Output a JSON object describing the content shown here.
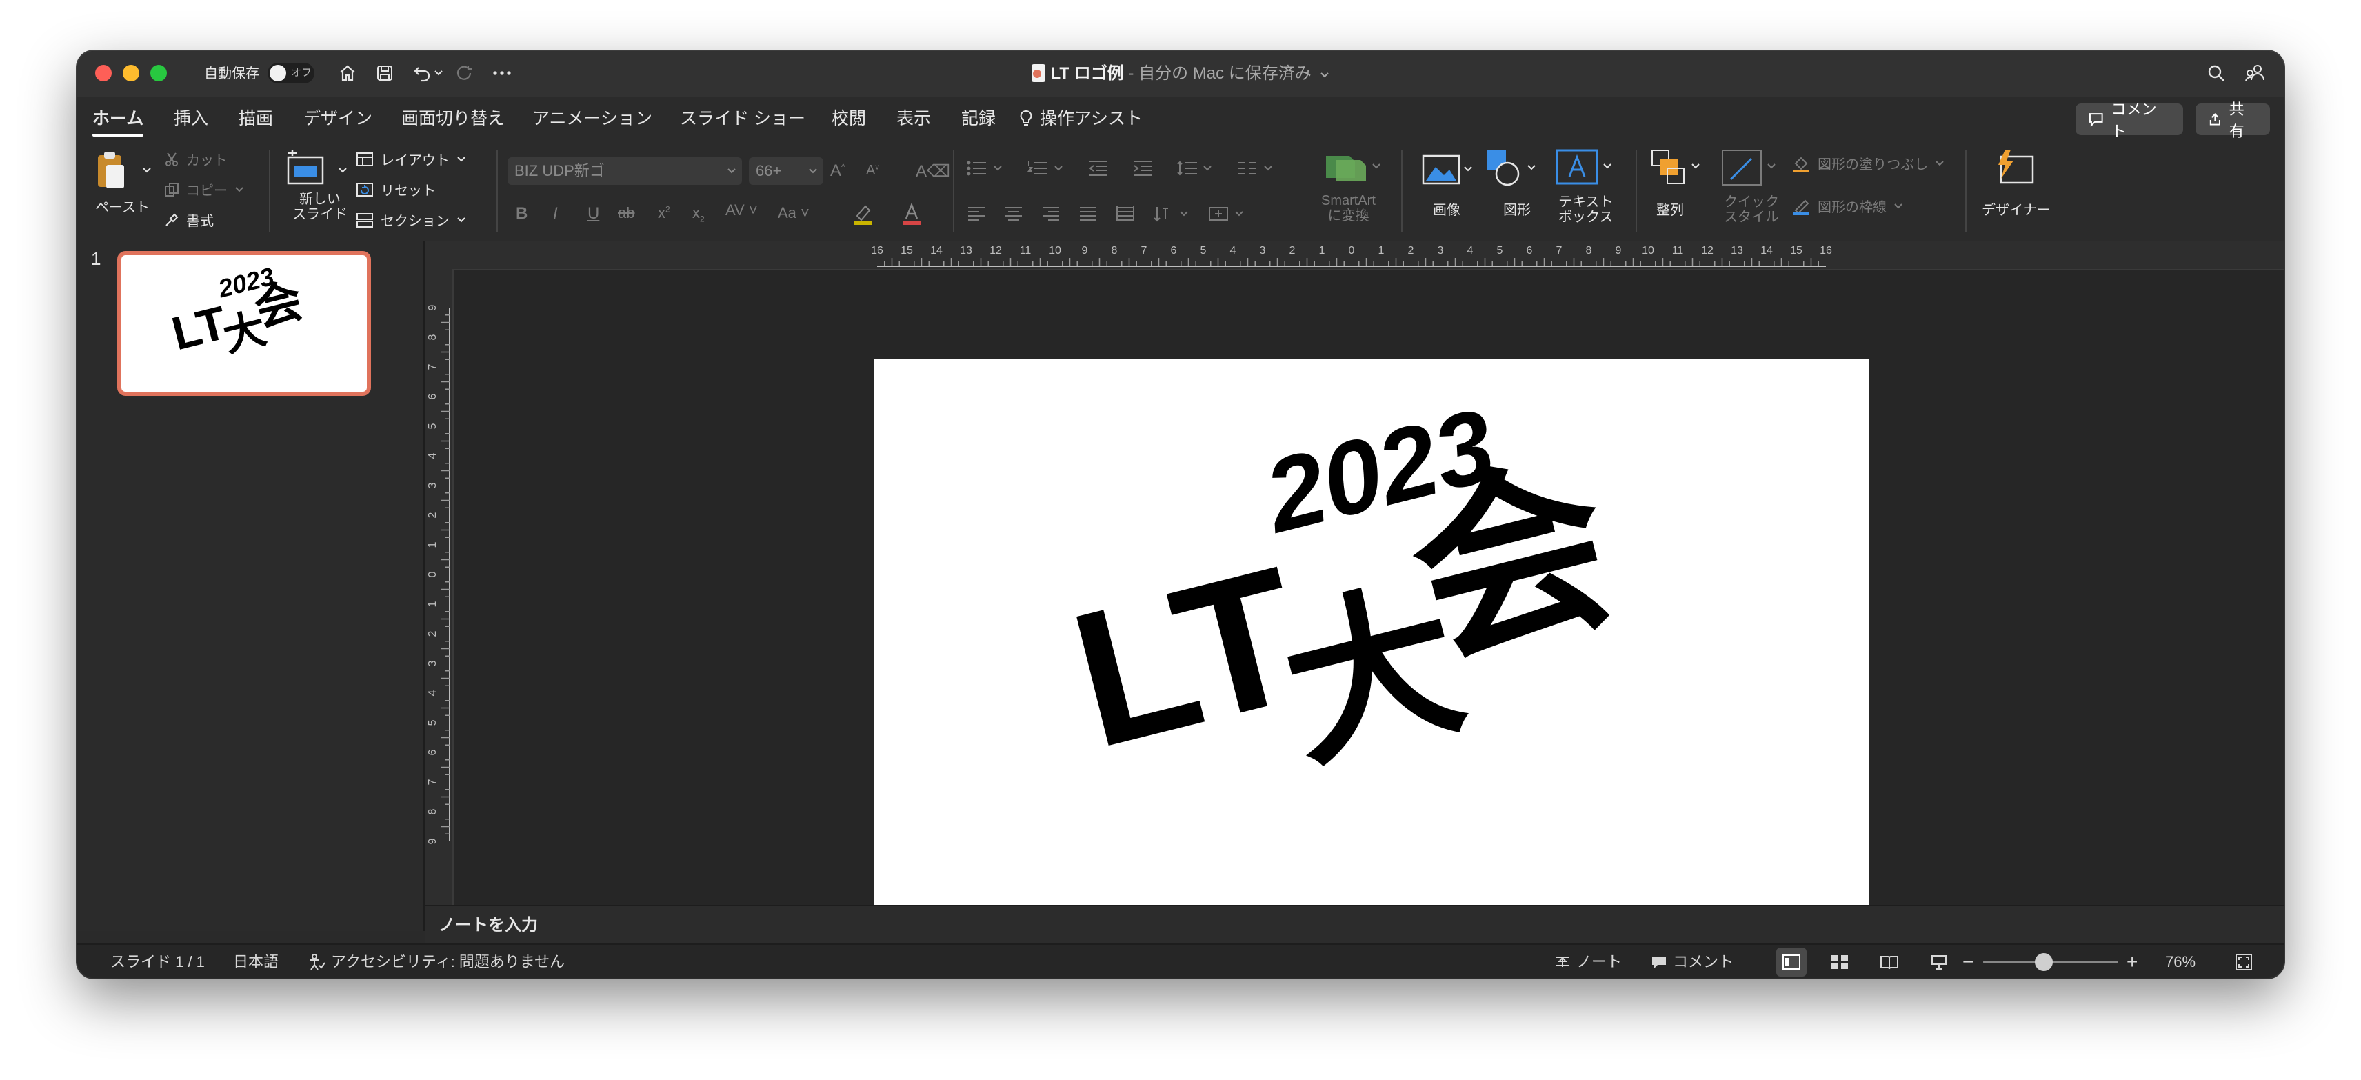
{
  "titlebar": {
    "autosave_label": "自動保存",
    "autosave_state": "オフ",
    "doc_name": "LT ロゴ例",
    "doc_location": " - 自分の Mac に保存済み",
    "icons": [
      "home-icon",
      "save-icon",
      "undo-icon",
      "redo-icon",
      "more-icon",
      "search-icon",
      "share-people-icon"
    ]
  },
  "tabs": [
    {
      "label": "ホーム",
      "active": true
    },
    {
      "label": "挿入"
    },
    {
      "label": "描画"
    },
    {
      "label": "デザイン"
    },
    {
      "label": "画面切り替え"
    },
    {
      "label": "アニメーション"
    },
    {
      "label": "スライド ショー"
    },
    {
      "label": "校閲"
    },
    {
      "label": "表示"
    },
    {
      "label": "記録"
    },
    {
      "label": "操作アシスト"
    }
  ],
  "actions": {
    "comment": "コメント",
    "share": "共有"
  },
  "ribbon": {
    "paste": "ペースト",
    "cut": "カット",
    "copy": "コピー",
    "format": "書式",
    "new_slide_1": "新しい",
    "new_slide_2": "スライド",
    "layout": "レイアウト",
    "reset": "リセット",
    "section": "セクション",
    "font_name": "BIZ UDP新ゴ",
    "font_size": "66+",
    "smartart_1": "SmartArt",
    "smartart_2": "に変換",
    "image": "画像",
    "shape": "図形",
    "textbox_1": "テキスト",
    "textbox_2": "ボックス",
    "arrange": "整列",
    "quickstyle_1": "クイック",
    "quickstyle_2": "スタイル",
    "shape_fill": "図形の塗りつぶし",
    "shape_outline": "図形の枠線",
    "designer": "デザイナー",
    "accent_orange": "#f0a030",
    "accent_blue": "#3a8ee6"
  },
  "thumbnails": [
    {
      "number": "1"
    }
  ],
  "ruler": {
    "h_ticks": [
      "16",
      "15",
      "14",
      "13",
      "12",
      "11",
      "10",
      "9",
      "8",
      "7",
      "6",
      "5",
      "4",
      "3",
      "2",
      "1",
      "0",
      "1",
      "2",
      "3",
      "4",
      "5",
      "6",
      "7",
      "8",
      "9",
      "10",
      "11",
      "12",
      "13",
      "14",
      "15",
      "16"
    ],
    "v_ticks": [
      "9",
      "8",
      "7",
      "6",
      "5",
      "4",
      "3",
      "2",
      "1",
      "0",
      "1",
      "2",
      "3",
      "4",
      "5",
      "6",
      "7",
      "8",
      "9"
    ]
  },
  "slide": {
    "year": "2023",
    "lt": "LT",
    "dai": "大",
    "kai": "会"
  },
  "notes": {
    "placeholder": "ノートを入力"
  },
  "status": {
    "slide_count": "スライド 1 / 1",
    "language": "日本語",
    "accessibility": "アクセシビリティ: 問題ありません",
    "notes": "ノート",
    "comments": "コメント",
    "zoom_minus": "−",
    "zoom_plus": "+",
    "zoom_percent": "76%",
    "zoom_level": 0.76
  }
}
